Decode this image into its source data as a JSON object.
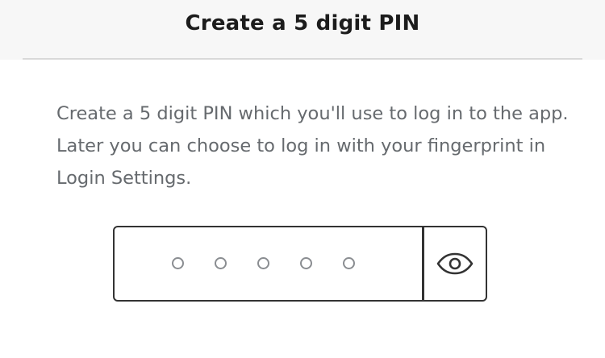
{
  "header": {
    "title": "Create a 5 digit PIN"
  },
  "instructions": {
    "text": "Create a 5 digit PIN which you'll use to log in to the app. Later you can choose to log in with your fingerprint in Login Settings."
  },
  "pin_input": {
    "digit_count": 5,
    "entered_count": 0,
    "toggle_icon": "eye-icon"
  },
  "colors": {
    "title": "#1c1c1c",
    "text": "#666a6e",
    "border": "#333333",
    "dot": "#8a8d91"
  }
}
